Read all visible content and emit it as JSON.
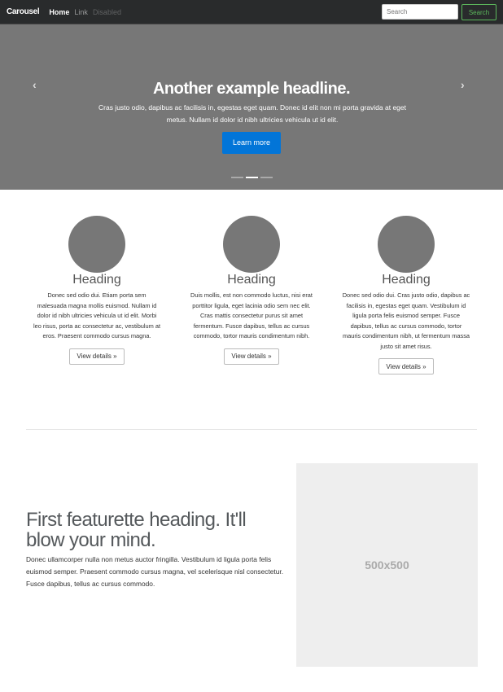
{
  "nav": {
    "brand": "Carousel",
    "links": [
      "Home",
      "Link",
      "Disabled"
    ],
    "search_placeholder": "Search",
    "search_button": "Search"
  },
  "carousel": {
    "headline": "Another example headline.",
    "text": "Cras justo odio, dapibus ac facilisis in, egestas eget quam. Donec id elit non mi porta gravida at eget metus. Nullam id dolor id nibh ultricies vehicula ut id elit.",
    "button": "Learn more",
    "prev": "‹",
    "next": "›",
    "active_slide": 2,
    "slide_count": 3
  },
  "columns": [
    {
      "heading": "Heading",
      "text": "Donec sed odio dui. Etiam porta sem malesuada magna mollis euismod. Nullam id dolor id nibh ultricies vehicula ut id elit. Morbi leo risus, porta ac consectetur ac, vestibulum at eros. Praesent commodo cursus magna.",
      "button": "View details »"
    },
    {
      "heading": "Heading",
      "text": "Duis mollis, est non commodo luctus, nisi erat porttitor ligula, eget lacinia odio sem nec elit. Cras mattis consectetur purus sit amet fermentum. Fusce dapibus, tellus ac cursus commodo, tortor mauris condimentum nibh.",
      "button": "View details »"
    },
    {
      "heading": "Heading",
      "text": "Donec sed odio dui. Cras justo odio, dapibus ac facilisis in, egestas eget quam. Vestibulum id ligula porta felis euismod semper. Fusce dapibus, tellus ac cursus commodo, tortor mauris condimentum nibh, ut fermentum massa justo sit amet risus.",
      "button": "View details »"
    }
  ],
  "featurette": {
    "heading": "First featurette heading. It'll blow your mind.",
    "text": "Donec ullamcorper nulla non metus auctor fringilla. Vestibulum id ligula porta felis euismod semper. Praesent commodo cursus magna, vel scelerisque nisl consectetur. Fusce dapibus, tellus ac cursus commodo.",
    "image_label": "500x500"
  }
}
